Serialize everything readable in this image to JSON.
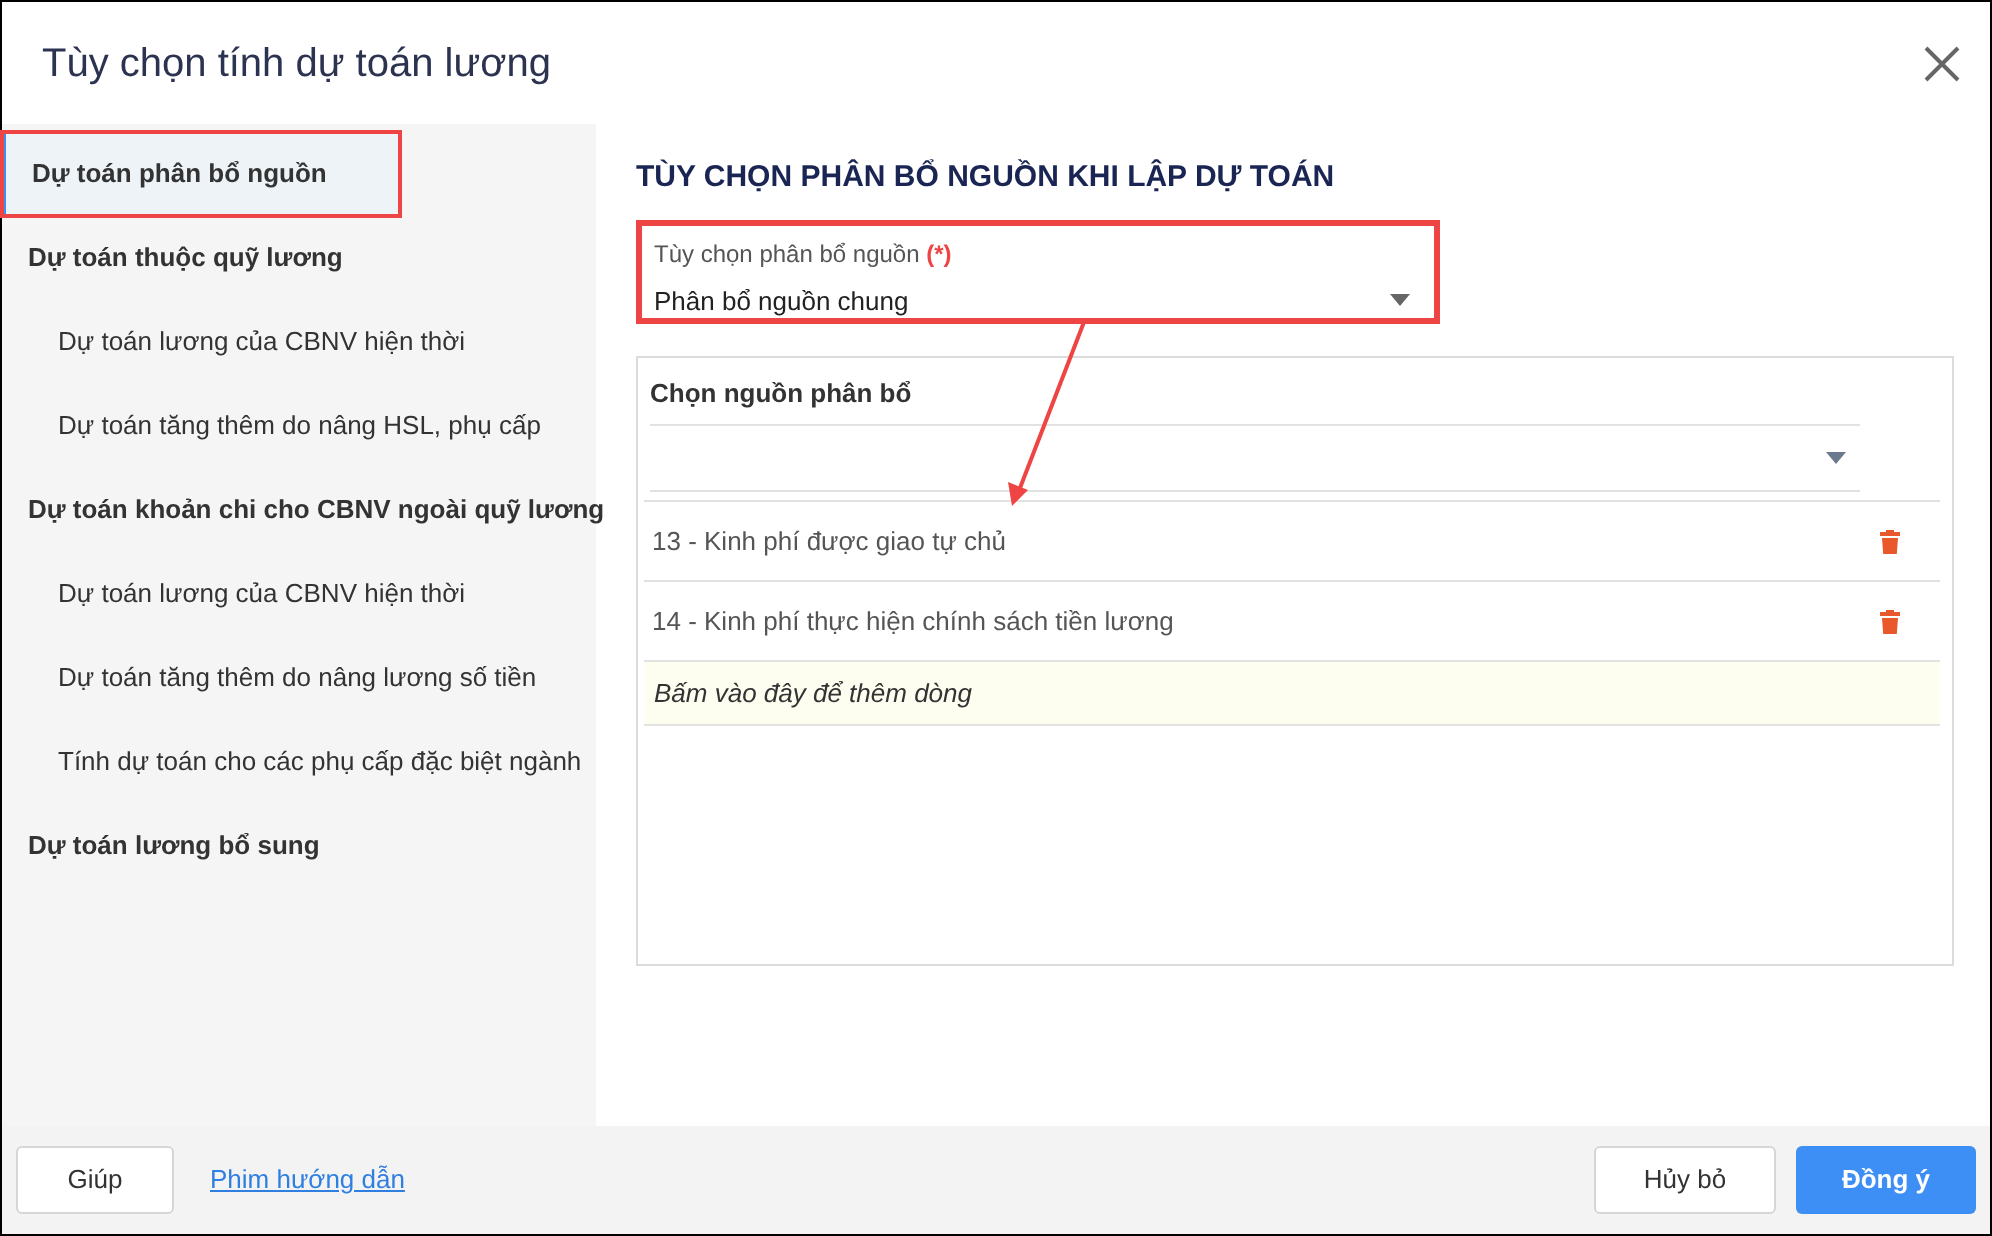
{
  "window": {
    "title": "Tùy chọn tính dự toán lương"
  },
  "sidebar": {
    "items": [
      {
        "label": "Dự toán phân bổ nguồn",
        "selected": true,
        "annotated": true
      },
      {
        "label": "Dự toán thuộc quỹ lương",
        "selected": false,
        "annotated": false,
        "children": [
          {
            "label": "Dự toán lương của CBNV hiện thời",
            "selected": false,
            "annotated": false
          },
          {
            "label": "Dự toán tăng thêm do nâng HSL, phụ cấp",
            "selected": false,
            "annotated": false
          }
        ]
      },
      {
        "label": "Dự toán khoản chi cho CBNV ngoài quỹ lương",
        "selected": false,
        "annotated": false,
        "children": [
          {
            "label": "Dự toán lương của CBNV hiện thời",
            "selected": false,
            "annotated": false
          },
          {
            "label": "Dự toán tăng thêm do nâng lương số tiền",
            "selected": false,
            "annotated": false
          },
          {
            "label": "Tính dự toán cho các phụ cấp đặc biệt ngành",
            "selected": false,
            "annotated": false
          }
        ]
      },
      {
        "label": "Dự toán lương bổ sung",
        "selected": false,
        "annotated": false
      }
    ]
  },
  "content": {
    "heading": "TÙY CHỌN PHÂN BỔ NGUỒN KHI LẬP DỰ TOÁN",
    "option_field": {
      "label": "Tùy chọn phân bổ nguồn",
      "required_mark": "(*)",
      "value": "Phân bổ nguồn chung",
      "annotated": true
    },
    "sources": {
      "title": "Chọn nguồn phân bổ",
      "rows": [
        {
          "text": "13 - Kinh phí được giao tự chủ"
        },
        {
          "text": "14 - Kinh phí thực hiện chính sách tiền lương"
        }
      ],
      "add_row": "Bấm vào đây để thêm dòng"
    }
  },
  "footer": {
    "help": "Giúp",
    "link": "Phim hướng dẫn",
    "cancel": "Hủy bỏ",
    "ok": "Đồng ý"
  }
}
